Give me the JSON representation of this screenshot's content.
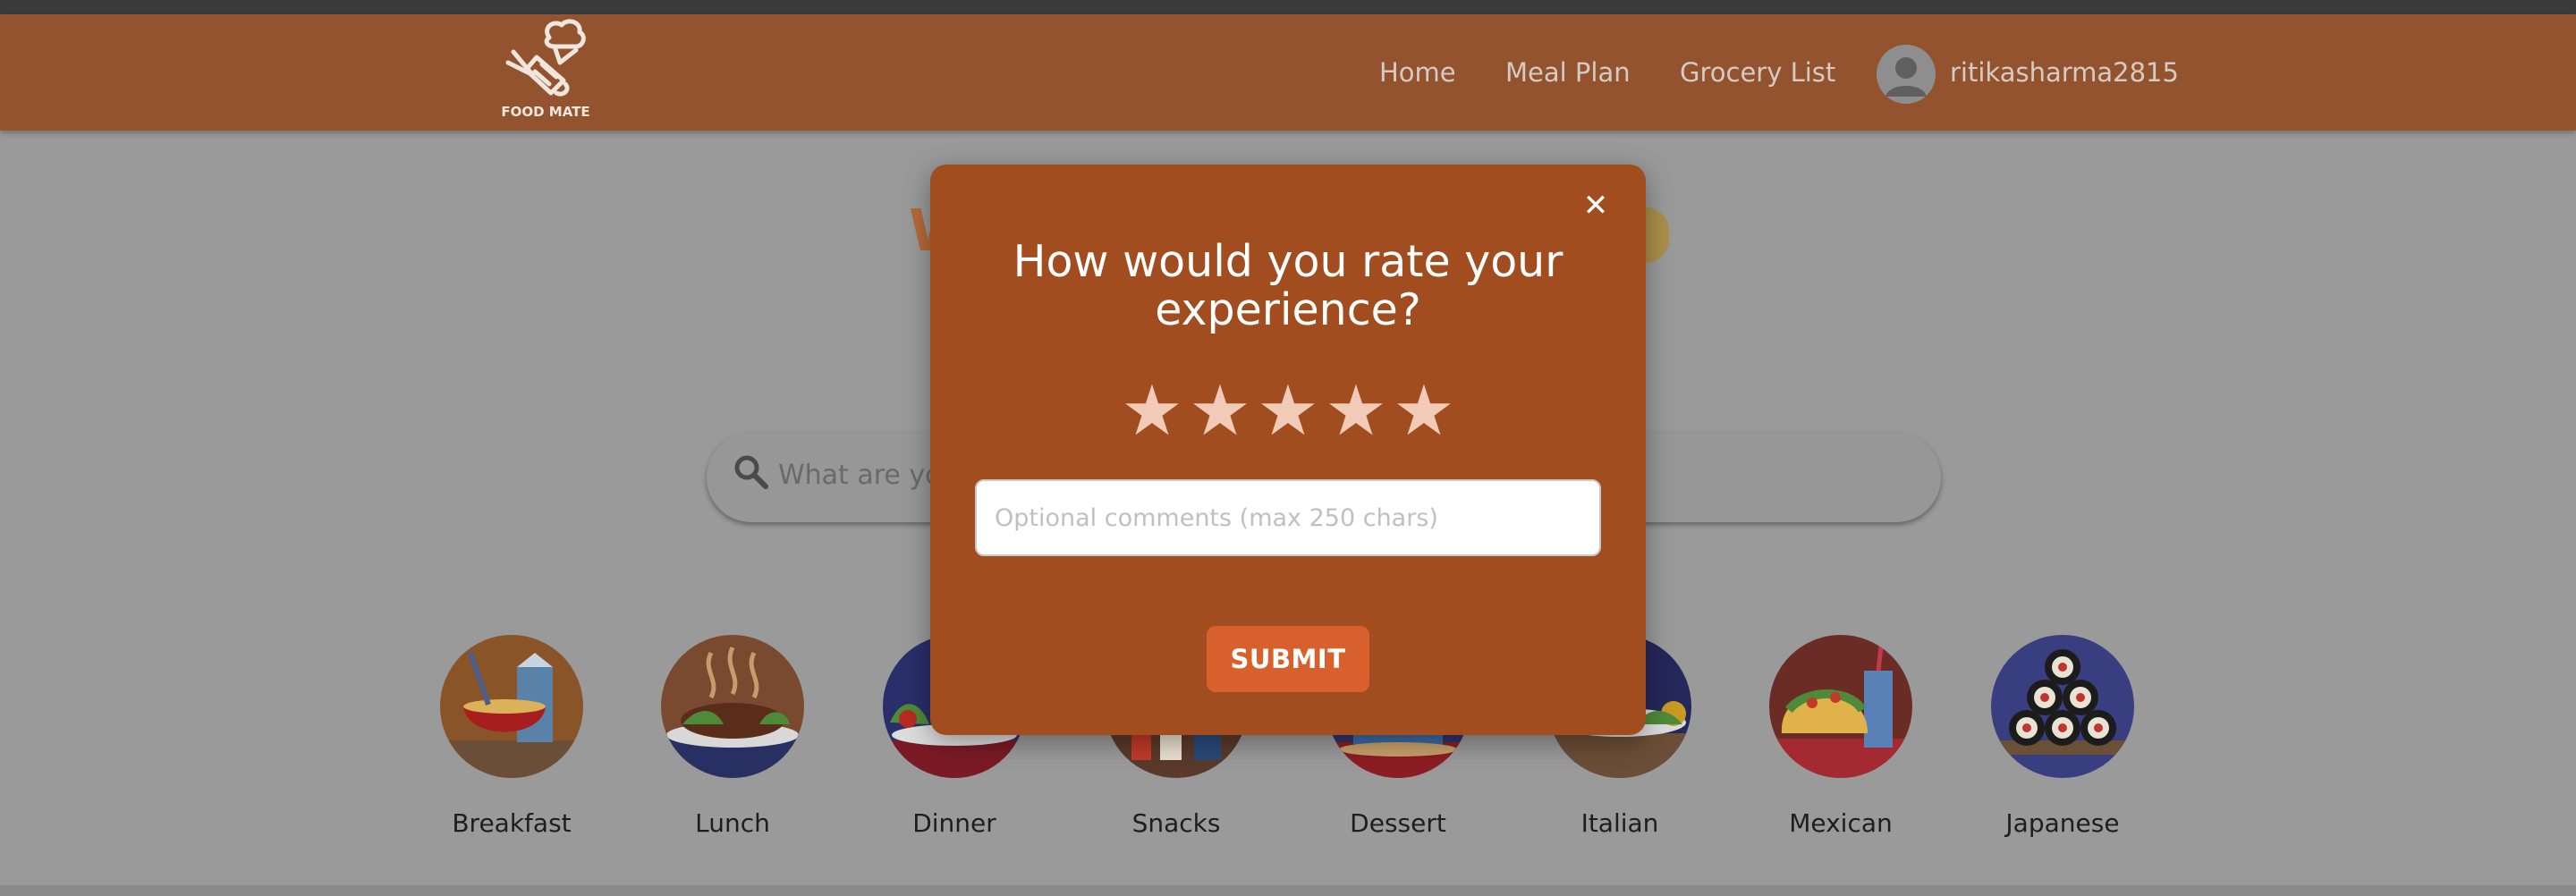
{
  "navbar": {
    "logo_text": "FOOD MATE",
    "links": [
      "Home",
      "Meal Plan",
      "Grocery List"
    ],
    "username": "ritikasharma2815"
  },
  "search": {
    "placeholder": "What are yo"
  },
  "categories": [
    "Breakfast",
    "Lunch",
    "Dinner",
    "Snacks",
    "Dessert",
    "Italian",
    "Mexican",
    "Japanese"
  ],
  "modal": {
    "close_icon": "close-icon",
    "title": "How would you rate your experience?",
    "star_count": 5,
    "rating": 0,
    "comment_placeholder": "Optional comments (max 250 chars)",
    "submit_label": "SUBMIT"
  },
  "colors": {
    "navbar": "#92532e",
    "modal": "#a14d1f",
    "submit": "#d8602c",
    "star": "#f1cbb7"
  }
}
